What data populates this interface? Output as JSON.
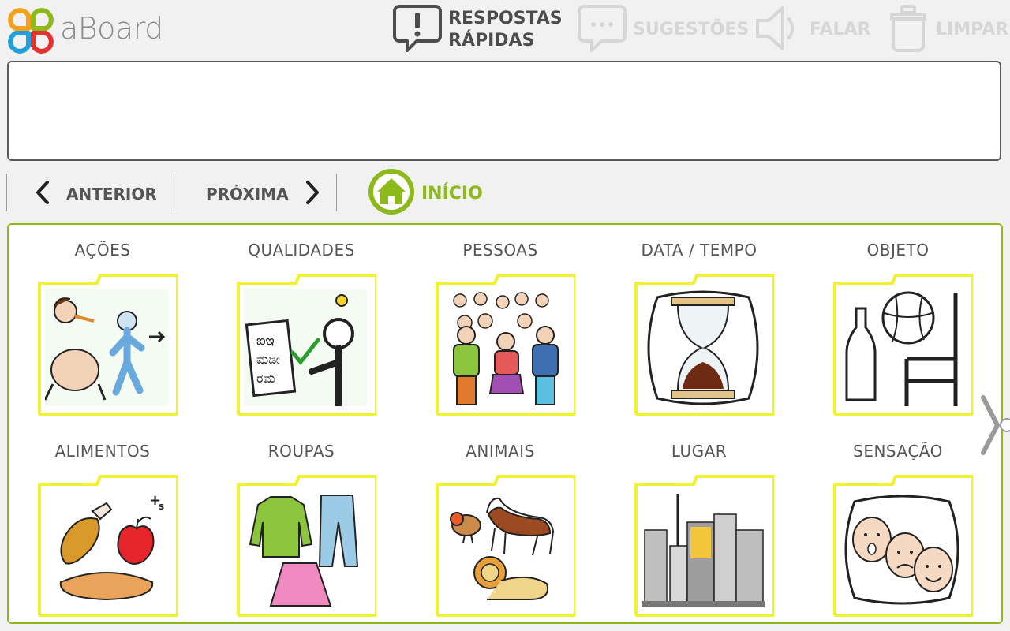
{
  "app": {
    "title": "aBoard"
  },
  "toolbar": {
    "quick": {
      "line1": "RESPOSTAS",
      "line2": "RÁPIDAS",
      "icon": "speech-bubble-exclamation-icon"
    },
    "suggestions": {
      "label": "SUGESTÕES",
      "icon": "speech-bubble-dots-icon"
    },
    "speak": {
      "label": "FALAR",
      "icon": "speaker-icon"
    },
    "clear": {
      "label": "LIMPAR",
      "icon": "trash-can-icon"
    }
  },
  "message": {
    "text": ""
  },
  "nav": {
    "previous": "ANTERIOR",
    "next": "PRÓXIMA",
    "home": "INÍCIO"
  },
  "colors": {
    "accent_green": "#8dba1a",
    "folder_yellow": "#eff231",
    "text_gray": "#555555",
    "disabled_gray": "#d6d6d6"
  },
  "categories": [
    {
      "label": "AÇÕES",
      "icon": "actions-pictogram"
    },
    {
      "label": "QUALIDADES",
      "icon": "qualities-pictogram"
    },
    {
      "label": "PESSOAS",
      "icon": "people-pictogram"
    },
    {
      "label": "DATA / TEMPO",
      "icon": "hourglass-pictogram"
    },
    {
      "label": "OBJETO",
      "icon": "objects-pictogram"
    },
    {
      "label": "ALIMENTOS",
      "icon": "food-pictogram"
    },
    {
      "label": "ROUPAS",
      "icon": "clothes-pictogram"
    },
    {
      "label": "ANIMAIS",
      "icon": "animals-pictogram"
    },
    {
      "label": "LUGAR",
      "icon": "city-pictogram"
    },
    {
      "label": "SENSAÇÃO",
      "icon": "faces-pictogram"
    }
  ]
}
